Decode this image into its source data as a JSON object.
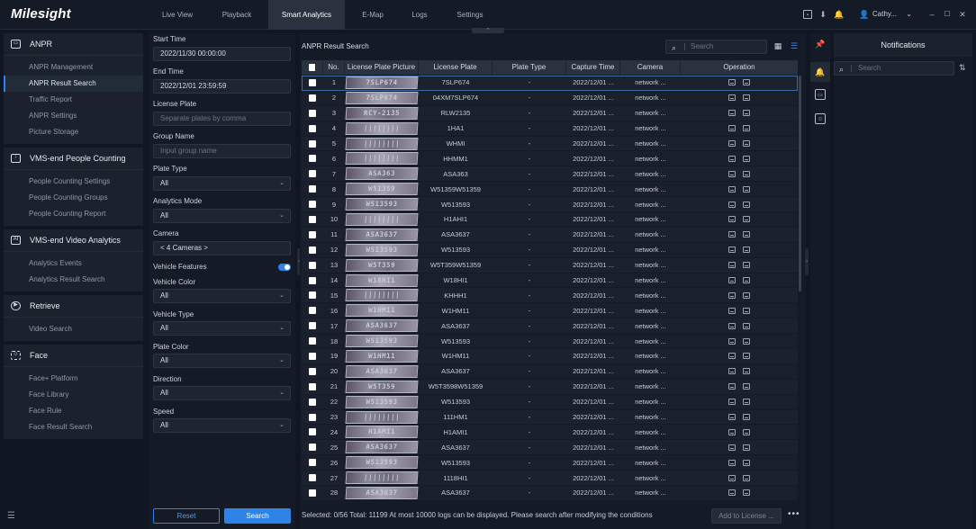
{
  "app": {
    "logo": "Milesight"
  },
  "nav": {
    "tabs": [
      {
        "label": "Live View",
        "active": false
      },
      {
        "label": "Playback",
        "active": false
      },
      {
        "label": "Smart Analytics",
        "active": true
      },
      {
        "label": "E-Map",
        "active": false
      },
      {
        "label": "Logs",
        "active": false
      },
      {
        "label": "Settings",
        "active": false
      }
    ],
    "tray_icons": [
      "monitor-icon",
      "download-icon",
      "bell-icon"
    ],
    "user": "Cathy...",
    "window_controls": {
      "minimize": "–",
      "maximize": "☐",
      "close": "✕"
    }
  },
  "sidebar": {
    "groups": [
      {
        "title": "ANPR",
        "icon": "car-icon",
        "items": [
          "ANPR Management",
          "ANPR Result Search",
          "Traffic Report",
          "ANPR Settings",
          "Picture Storage"
        ]
      },
      {
        "title": "VMS-end People Counting",
        "icon": "people-counting-icon",
        "items": [
          "People Counting Settings",
          "People Counting Groups",
          "People Counting Report"
        ]
      },
      {
        "title": "VMS-end Video Analytics",
        "icon": "ai-icon",
        "items": [
          "Analytics Events",
          "Analytics Result Search"
        ]
      },
      {
        "title": "Retrieve",
        "icon": "play-circle-icon",
        "items": [
          "Video Search"
        ]
      },
      {
        "title": "Face",
        "icon": "face-icon",
        "items": [
          "Face+ Platform",
          "Face Library",
          "Face Rule",
          "Face Result Search"
        ]
      }
    ],
    "active_item": "ANPR Result Search"
  },
  "filters": {
    "start_time": {
      "label": "Start Time",
      "value": "2022/11/30 00:00:00"
    },
    "end_time": {
      "label": "End Time",
      "value": "2022/12/01 23:59:59"
    },
    "license_plate": {
      "label": "License Plate",
      "placeholder": "Separate plates by comma"
    },
    "group_name": {
      "label": "Group Name",
      "placeholder": "Input group name"
    },
    "plate_type": {
      "label": "Plate Type",
      "value": "All"
    },
    "analytics_mode": {
      "label": "Analytics Mode",
      "value": "All"
    },
    "camera": {
      "label": "Camera",
      "value": "< 4 Cameras >"
    },
    "vehicle_features": {
      "label": "Vehicle Features",
      "enabled": true
    },
    "vehicle_color": {
      "label": "Vehicle Color",
      "value": "All"
    },
    "vehicle_type": {
      "label": "Vehicle Type",
      "value": "All"
    },
    "plate_color": {
      "label": "Plate Color",
      "value": "All"
    },
    "direction": {
      "label": "Direction",
      "value": "All"
    },
    "speed": {
      "label": "Speed",
      "value": "All"
    },
    "reset_label": "Reset",
    "search_label": "Search"
  },
  "results": {
    "title": "ANPR Result Search",
    "search_placeholder": "Search",
    "columns": [
      "No.",
      "License Plate Picture",
      "License Plate",
      "Plate Type",
      "Capture Time",
      "Camera",
      "Operation"
    ],
    "rows": [
      {
        "no": "1",
        "pic": "7SLP674",
        "plate": "7SLP674",
        "type": "-",
        "time": "2022/12/01 ...",
        "camera": "network ..."
      },
      {
        "no": "2",
        "pic": "7SLP674",
        "plate": "04XM7SLP674",
        "type": "-",
        "time": "2022/12/01 ...",
        "camera": "network ..."
      },
      {
        "no": "3",
        "pic": "RCY-2135",
        "plate": "RLW2135",
        "type": "-",
        "time": "2022/12/01 ...",
        "camera": "network ..."
      },
      {
        "no": "4",
        "pic": "||||||||",
        "plate": "1HA1",
        "type": "-",
        "time": "2022/12/01 ...",
        "camera": "network ..."
      },
      {
        "no": "5",
        "pic": "||||||||",
        "plate": "WHMI",
        "type": "-",
        "time": "2022/12/01 ...",
        "camera": "network ..."
      },
      {
        "no": "6",
        "pic": "||||||||",
        "plate": "HHMM1",
        "type": "-",
        "time": "2022/12/01 ...",
        "camera": "network ..."
      },
      {
        "no": "7",
        "pic": "ASA363",
        "plate": "ASA363",
        "type": "-",
        "time": "2022/12/01 ...",
        "camera": "network ..."
      },
      {
        "no": "8",
        "pic": "W51359",
        "plate": "W51359W51359",
        "type": "-",
        "time": "2022/12/01 ...",
        "camera": "network ..."
      },
      {
        "no": "9",
        "pic": "W513593",
        "plate": "W513593",
        "type": "-",
        "time": "2022/12/01 ...",
        "camera": "network ..."
      },
      {
        "no": "10",
        "pic": "||||||||",
        "plate": "H1AHI1",
        "type": "-",
        "time": "2022/12/01 ...",
        "camera": "network ..."
      },
      {
        "no": "11",
        "pic": "ASA3637",
        "plate": "ASA3637",
        "type": "-",
        "time": "2022/12/01 ...",
        "camera": "network ..."
      },
      {
        "no": "12",
        "pic": "W513593",
        "plate": "W513593",
        "type": "-",
        "time": "2022/12/01 ...",
        "camera": "network ..."
      },
      {
        "no": "13",
        "pic": "W5T359",
        "plate": "W5T359W51359",
        "type": "-",
        "time": "2022/12/01 ...",
        "camera": "network ..."
      },
      {
        "no": "14",
        "pic": "W18HI1",
        "plate": "W18HI1",
        "type": "-",
        "time": "2022/12/01 ...",
        "camera": "network ..."
      },
      {
        "no": "15",
        "pic": "||||||||",
        "plate": "KHHH1",
        "type": "-",
        "time": "2022/12/01 ...",
        "camera": "network ..."
      },
      {
        "no": "16",
        "pic": "W1HM11",
        "plate": "W1HM11",
        "type": "-",
        "time": "2022/12/01 ...",
        "camera": "network ..."
      },
      {
        "no": "17",
        "pic": "ASA3637",
        "plate": "ASA3637",
        "type": "-",
        "time": "2022/12/01 ...",
        "camera": "network ..."
      },
      {
        "no": "18",
        "pic": "W513593",
        "plate": "W513593",
        "type": "-",
        "time": "2022/12/01 ...",
        "camera": "network ..."
      },
      {
        "no": "19",
        "pic": "W1HM11",
        "plate": "W1HM11",
        "type": "-",
        "time": "2022/12/01 ...",
        "camera": "network ..."
      },
      {
        "no": "20",
        "pic": "ASA3637",
        "plate": "ASA3637",
        "type": "-",
        "time": "2022/12/01 ...",
        "camera": "network ..."
      },
      {
        "no": "21",
        "pic": "W5T359",
        "plate": "W5T3598W51359",
        "type": "-",
        "time": "2022/12/01 ...",
        "camera": "network ..."
      },
      {
        "no": "22",
        "pic": "W513593",
        "plate": "W513593",
        "type": "-",
        "time": "2022/12/01 ...",
        "camera": "network ..."
      },
      {
        "no": "23",
        "pic": "||||||||",
        "plate": "111HM1",
        "type": "-",
        "time": "2022/12/01 ...",
        "camera": "network ..."
      },
      {
        "no": "24",
        "pic": "H1AMI1",
        "plate": "H1AMI1",
        "type": "-",
        "time": "2022/12/01 ...",
        "camera": "network ..."
      },
      {
        "no": "25",
        "pic": "ASA3637",
        "plate": "ASA3637",
        "type": "-",
        "time": "2022/12/01 ...",
        "camera": "network ..."
      },
      {
        "no": "26",
        "pic": "W513593",
        "plate": "W513593",
        "type": "-",
        "time": "2022/12/01 ...",
        "camera": "network ..."
      },
      {
        "no": "27",
        "pic": "||||||||",
        "plate": "1118HI1",
        "type": "-",
        "time": "2022/12/01 ...",
        "camera": "network ..."
      },
      {
        "no": "28",
        "pic": "ASA3637",
        "plate": "ASA3637",
        "type": "-",
        "time": "2022/12/01 ...",
        "camera": "network ..."
      }
    ],
    "footer_text": "Selected: 0/56  Total: 11199  At most 10000 logs can be displayed. Please search after modifying the conditions",
    "add_to_license_label": "Add to License ...",
    "more_label": "•••"
  },
  "notifications": {
    "title": "Notifications",
    "search_placeholder": "Search"
  },
  "colors": {
    "accent": "#2f83e6",
    "background": "#111722",
    "panel": "#151b26"
  }
}
